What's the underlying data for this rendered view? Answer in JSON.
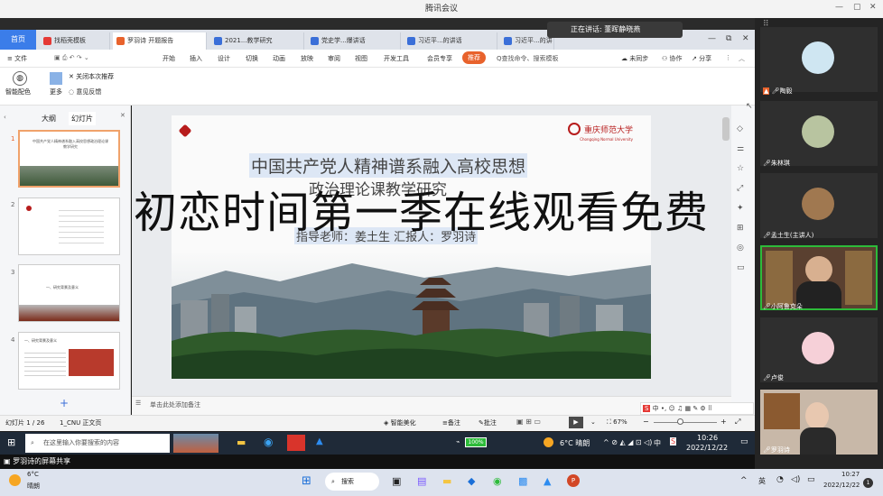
{
  "meeting_title": "腾讯会议",
  "speaking": "正在讲话: 董晖静晓燕",
  "tabs": [
    "首页",
    "找稻壳模板",
    "罗羽诗 开题报告",
    "2021...教学研究",
    "党史学...爆讲话",
    "习近平...的讲话",
    "习近平...的讲话"
  ],
  "menu": {
    "file": "文件",
    "items": [
      "开始",
      "插入",
      "设计",
      "切换",
      "动画",
      "放映",
      "审阅",
      "视图",
      "开发工具",
      "会员专享"
    ],
    "recommend": "推荐",
    "search_placeholder": "Q查找命令、搜索模板",
    "unsync": "未同步",
    "collab": "协作",
    "share": "分享"
  },
  "ribbon": {
    "smart": "智能配色",
    "more": "更多",
    "close_rec": "关闭本次推荐",
    "feedback": "意见反馈"
  },
  "panel_tabs": [
    "大纲",
    "幻灯片"
  ],
  "thumbs": [
    {
      "n": "1",
      "text": "中国共产党人精神谱系融入高校思想政治理论课教学研究"
    },
    {
      "n": "2",
      "text": ""
    },
    {
      "n": "3",
      "text": "一、研究背景及意义"
    },
    {
      "n": "4",
      "text": "一、研究背景及意义"
    }
  ],
  "slide": {
    "university": "重庆师范大学",
    "university_en": "Chongqing Normal University",
    "title_line1": "中国共产党人精神谱系融入高校思想",
    "title_line2": "政治理论课教学研究",
    "authors": "指导老师：姜土生    汇报人：罗羽诗"
  },
  "overlay": "初恋时间第一季在线观看免费",
  "notes_placeholder": "单击此处添加备注",
  "status": {
    "slide": "幻灯片 1 / 26",
    "theme": "1_CNU 正文页",
    "beautify": "智能美化",
    "notes": "备注",
    "comments": "批注",
    "zoom": "67%"
  },
  "inner_taskbar": {
    "search": "在这里输入你要搜索的内容",
    "battery": "100%",
    "weather": "6°C  晴朗",
    "lang": "中",
    "time": "10:26",
    "date": "2022/12/22"
  },
  "meeting_share": "罗羽诗的屏幕共享",
  "participants": [
    "陶毅",
    "朱林琪",
    "孟土生(主讲人)",
    "小阿鲁克朵",
    "卢俊",
    "罗羽诗"
  ],
  "win_taskbar": {
    "weather_temp": "6°C",
    "weather_desc": "晴朗",
    "search": "搜索",
    "lang": "英",
    "time": "10:27",
    "date": "2022/12/22",
    "badge": "1"
  }
}
